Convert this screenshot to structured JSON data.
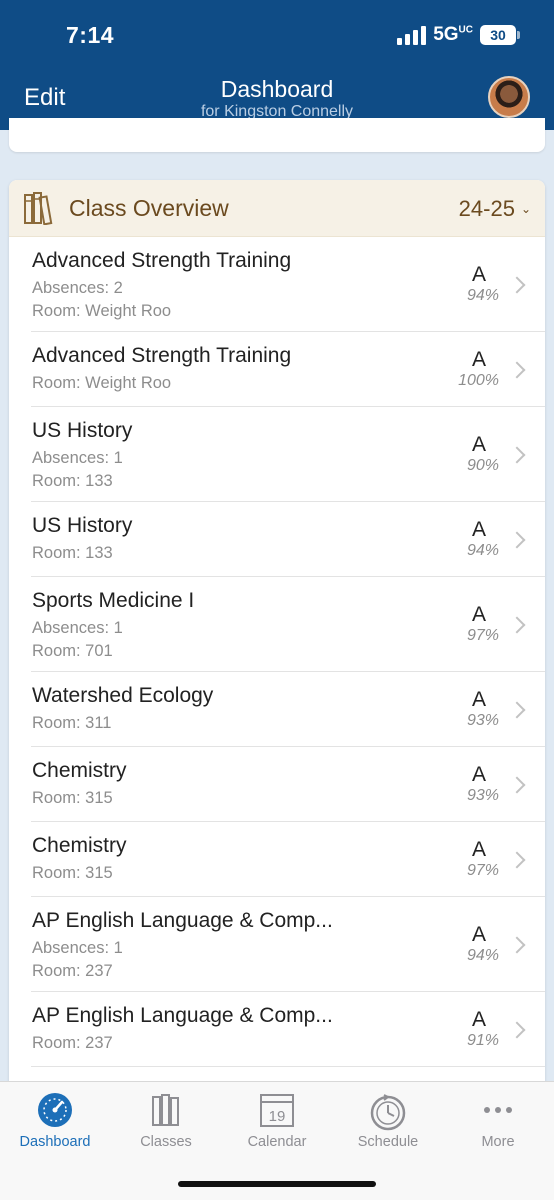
{
  "status_bar": {
    "time": "7:14",
    "network": "5G",
    "network_sup": "UC",
    "battery": "30"
  },
  "header": {
    "edit_label": "Edit",
    "title": "Dashboard",
    "subtitle": "for Kingston Connelly"
  },
  "overview": {
    "title": "Class Overview",
    "year": "24-25"
  },
  "classes": [
    {
      "name": "Advanced Strength Training",
      "lines": [
        "Absences: 2",
        "Room: Weight Roo"
      ],
      "grade": "A",
      "percent": "94%"
    },
    {
      "name": "Advanced Strength Training",
      "lines": [
        "Room: Weight Roo"
      ],
      "grade": "A",
      "percent": "100%"
    },
    {
      "name": "US History",
      "lines": [
        "Absences: 1",
        "Room: 133"
      ],
      "grade": "A",
      "percent": "90%"
    },
    {
      "name": "US History",
      "lines": [
        "Room: 133"
      ],
      "grade": "A",
      "percent": "94%"
    },
    {
      "name": "Sports Medicine I",
      "lines": [
        "Absences: 1",
        "Room: 701"
      ],
      "grade": "A",
      "percent": "97%"
    },
    {
      "name": "Watershed Ecology",
      "lines": [
        "Room: 311"
      ],
      "grade": "A",
      "percent": "93%"
    },
    {
      "name": "Chemistry",
      "lines": [
        "Room: 315"
      ],
      "grade": "A",
      "percent": "93%"
    },
    {
      "name": "Chemistry",
      "lines": [
        "Room: 315"
      ],
      "grade": "A",
      "percent": "97%"
    },
    {
      "name": "AP English Language & Comp...",
      "lines": [
        "Absences: 1",
        "Room: 237"
      ],
      "grade": "A",
      "percent": "94%"
    },
    {
      "name": "AP English Language & Comp...",
      "lines": [
        "Room: 237"
      ],
      "grade": "A",
      "percent": "91%"
    }
  ],
  "tabs": [
    {
      "label": "Dashboard",
      "icon": "dashboard-icon",
      "active": true
    },
    {
      "label": "Classes",
      "icon": "classes-icon",
      "active": false
    },
    {
      "label": "Calendar",
      "icon": "calendar-icon",
      "active": false,
      "day": "19"
    },
    {
      "label": "Schedule",
      "icon": "schedule-icon",
      "active": false
    },
    {
      "label": "More",
      "icon": "more-icon",
      "active": false
    }
  ],
  "colors": {
    "header": "#0f4c86",
    "accent": "#1d6fb8",
    "overview_text": "#6b4a1f",
    "overview_bg": "#f6f1e6"
  }
}
